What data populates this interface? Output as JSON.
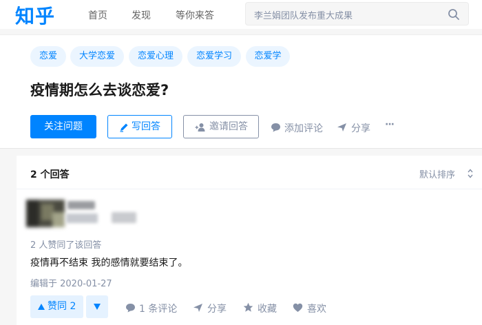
{
  "header": {
    "logo": "知乎",
    "nav": [
      "首页",
      "发现",
      "等你来答"
    ],
    "search_placeholder": "李兰娟团队发布重大成果"
  },
  "question": {
    "tags": [
      "恋爱",
      "大学恋爱",
      "恋爱心理",
      "恋爱学习",
      "恋爱学"
    ],
    "title": "疫情期怎么去谈恋爱?",
    "follow_label": "关注问题",
    "write_label": "写回答",
    "invite_label": "邀请回答",
    "comment_label": "添加评论",
    "share_label": "分享",
    "more_label": "···"
  },
  "answers": {
    "count_label": "2 个回答",
    "sort_label": "默认排序",
    "item": {
      "votes_meta": "2 人赞同了该回答",
      "content": "疫情再不结束 我的感情就要结束了。",
      "edited": "编辑于 2020-01-27",
      "upvote_label": "赞同 2",
      "comments_label": "1 条评论",
      "share_label": "分享",
      "collect_label": "收藏",
      "like_label": "喜欢"
    }
  },
  "colors": {
    "brand": "#0084ff",
    "muted": "#8590a6"
  }
}
